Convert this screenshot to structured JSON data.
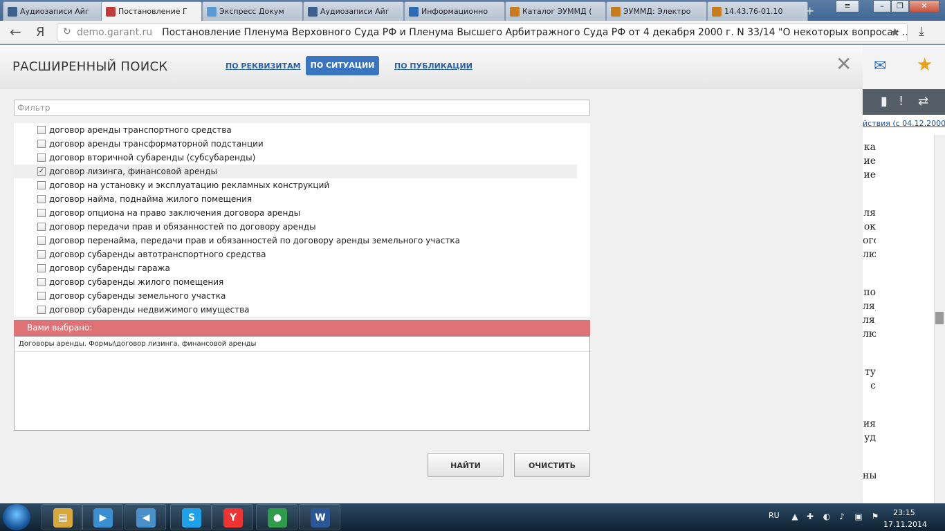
{
  "browser": {
    "tabs": [
      {
        "label": "Аудиозаписи Айг",
        "icon": "play-icon",
        "color": "#3d5f8c"
      },
      {
        "label": "Постановление Г",
        "icon": "garant-icon",
        "color": "#c23b3b"
      },
      {
        "label": "Экспресс Докум",
        "icon": "snowflake-icon",
        "color": "#5b9bd5"
      },
      {
        "label": "Аудиозаписи Айг",
        "icon": "pause-icon",
        "color": "#3d5f8c"
      },
      {
        "label": "Информационно",
        "icon": "is-icon",
        "color": "#2d6bb5"
      },
      {
        "label": "Каталог ЭУММД (",
        "icon": "tm-icon",
        "color": "#c77d1e"
      },
      {
        "label": "ЭУММД: Электро",
        "icon": "tm-icon",
        "color": "#c77d1e"
      },
      {
        "label": "14.43.76-01.10",
        "icon": "tm-icon",
        "color": "#c77d1e"
      }
    ],
    "new_tab": "+",
    "window_buttons": {
      "menu": "≡",
      "minimize": "–",
      "restore": "❐",
      "close": "✕"
    },
    "back": "←",
    "yandex": "Я",
    "url_host": "demo.garant.ru",
    "url_title": "Постановление Пленума Верховного Суда РФ и Пленума Высшего Арбитражного Суда РФ от 4 декабря 2000 г. N 33/14 \"О некоторых вопросах …",
    "bookmark_star": "★",
    "download": "⤓"
  },
  "background_page": {
    "edition_link": "йствия (с 04.12.2000)",
    "text_fragments": [
      "ка",
      "ие",
      "ие",
      "ля",
      "ок",
      "ого",
      "лю",
      "по",
      "ля,",
      "ля,",
      "лю",
      "ту",
      "с",
      "ия",
      "уд",
      "ны"
    ],
    "tool_icons": [
      "bookmark-icon",
      "warning-icon",
      "swap-icon"
    ],
    "tool_glyphs": [
      "▮",
      "!",
      "⇄"
    ]
  },
  "modal": {
    "title": "РАСШИРЕННЫЙ ПОИСК",
    "tabs": {
      "by_details": "ПО РЕКВИЗИТАМ",
      "by_situation": "ПО СИТУАЦИИ",
      "by_publication": "ПО ПУБЛИКАЦИИ"
    },
    "close": "✕",
    "filter_placeholder": "Фильтр",
    "filter_value": "",
    "tree_items": [
      {
        "label": "договор аренды транспортного средства",
        "checked": false
      },
      {
        "label": "договор аренды трансформаторной подстанции",
        "checked": false
      },
      {
        "label": "договор вторичной субаренды (субсубаренды)",
        "checked": false
      },
      {
        "label": "договор лизинга, финансовой аренды",
        "checked": true
      },
      {
        "label": "договор на установку и эксплуатацию рекламных конструкций",
        "checked": false
      },
      {
        "label": "договор найма, поднайма жилого помещения",
        "checked": false
      },
      {
        "label": "договор опциона на право заключения договора аренды",
        "checked": false
      },
      {
        "label": "договор передачи прав и обязанностей по договору аренды",
        "checked": false
      },
      {
        "label": "договор перенайма, передачи прав и обязанностей по договору аренды земельного участка",
        "checked": false
      },
      {
        "label": "договор субаренды автотранспортного средства",
        "checked": false
      },
      {
        "label": "договор субаренды гаража",
        "checked": false
      },
      {
        "label": "договор субаренды жилого помещения",
        "checked": false
      },
      {
        "label": "договор субаренды земельного участка",
        "checked": false
      },
      {
        "label": "договор субаренды недвижимого имущества",
        "checked": false
      }
    ],
    "scroll_up": "▲",
    "scroll_down": "▼",
    "selected_header": "Вами выбрано:",
    "selected_items": [
      "Договоры аренды. Формы\\договор лизинга, финансовой аренды"
    ],
    "find_button": "НАЙТИ",
    "clear_button": "ОЧИСТИТЬ"
  },
  "taskbar": {
    "apps": [
      {
        "name": "explorer-icon",
        "glyph": "▤",
        "color": "#d8a93a"
      },
      {
        "name": "media-player-icon",
        "glyph": "▶",
        "color": "#3a8fd0"
      },
      {
        "name": "speaker-icon",
        "glyph": "◀",
        "color": "#4a90c8"
      },
      {
        "name": "skype-icon",
        "glyph": "S",
        "color": "#1da1e8"
      },
      {
        "name": "yandex-browser-icon",
        "glyph": "Y",
        "color": "#e33"
      },
      {
        "name": "chrome-icon",
        "glyph": "●",
        "color": "#2e9c4a"
      },
      {
        "name": "word-icon",
        "glyph": "W",
        "color": "#2b5797"
      }
    ],
    "language": "RU",
    "tray_glyphs": [
      "▲",
      "✚",
      "◐",
      "♪",
      "▣",
      "⚑"
    ],
    "time": "23:15",
    "date": "17.11.2014"
  }
}
